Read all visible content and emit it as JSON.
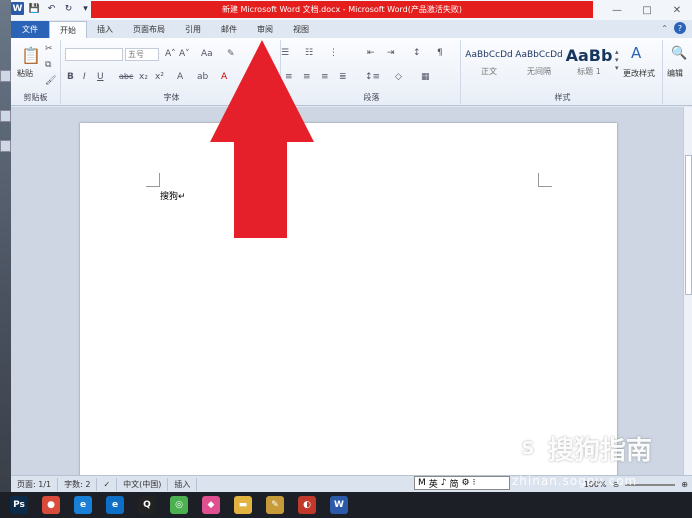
{
  "window": {
    "title": "新建 Microsoft Word 文档.docx - Microsoft Word(产品激活失败)",
    "controls": [
      "—",
      "□",
      "✕"
    ]
  },
  "tabs": [
    "文件",
    "开始",
    "插入",
    "页面布局",
    "引用",
    "邮件",
    "审阅",
    "视图"
  ],
  "ribbon": {
    "clipboard": {
      "label": "剪贴板",
      "paste": "粘贴"
    },
    "font": {
      "label": "字体",
      "size": "五号",
      "bold": "B",
      "italic": "I",
      "underline": "U",
      "strike": "abc",
      "sub": "x₂",
      "sup": "x²"
    },
    "paragraph": {
      "label": "段落"
    },
    "styles": {
      "label": "样式",
      "items": [
        {
          "preview": "AaBbCcDd",
          "name": "正文"
        },
        {
          "preview": "AaBbCcDd",
          "name": "无间隔"
        },
        {
          "preview": "AaBb",
          "name": "标题 1"
        }
      ],
      "change": "更改样式"
    },
    "editing": {
      "label": "编辑"
    }
  },
  "document": {
    "text": "搜狗↵"
  },
  "statusbar": {
    "page": "页面: 1/1",
    "words": "字数: 2",
    "language": "中文(中国)",
    "mode": "插入",
    "zoom": "100%"
  },
  "ime": {
    "items": [
      "M",
      "英",
      "♪",
      "简",
      "⚙",
      "⁝"
    ]
  },
  "watermark": {
    "brand": "搜狗指南",
    "url": "zhinan.sogou.com"
  },
  "taskbar": {
    "apps": [
      {
        "name": "photoshop-icon",
        "label": "Ps",
        "color": "#0b2a48"
      },
      {
        "name": "chrome-icon",
        "label": "●",
        "color": "#d94b3a"
      },
      {
        "name": "ie-icon",
        "label": "e",
        "color": "#1a7fd6"
      },
      {
        "name": "edge-icon",
        "label": "e",
        "color": "#0f6fc6"
      },
      {
        "name": "qq-icon",
        "label": "Q",
        "color": "#222"
      },
      {
        "name": "browser-icon",
        "label": "◎",
        "color": "#4caf50"
      },
      {
        "name": "balloon-icon",
        "label": "◆",
        "color": "#e05090"
      },
      {
        "name": "explorer-icon",
        "label": "▬",
        "color": "#e3b341"
      },
      {
        "name": "brush-icon",
        "label": "✎",
        "color": "#c79a3a"
      },
      {
        "name": "paint-icon",
        "label": "◐",
        "color": "#c0392b"
      },
      {
        "name": "word-icon",
        "label": "W",
        "color": "#2b5aa8"
      }
    ]
  },
  "colors": {
    "title_bar_red": "#e41d1d",
    "arrow_red": "#e5202a",
    "file_tab_blue": "#2b63b6"
  }
}
